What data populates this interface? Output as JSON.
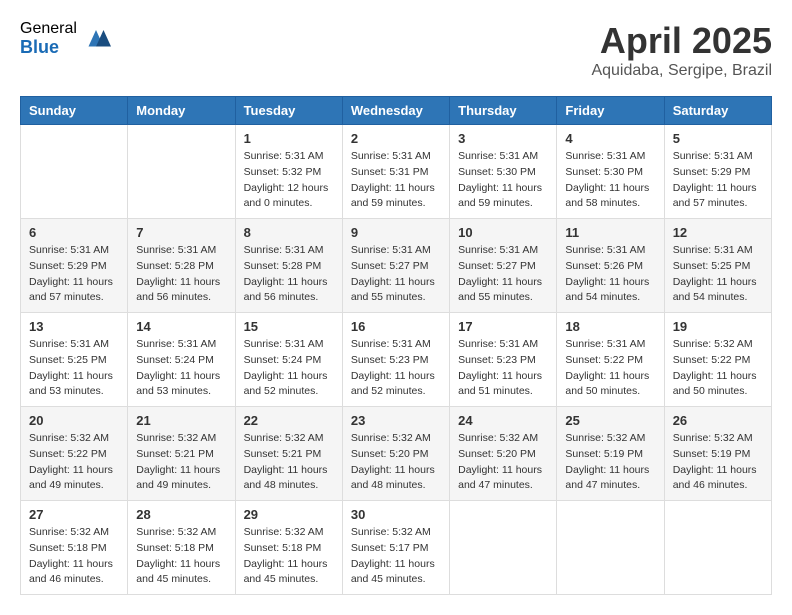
{
  "logo": {
    "general": "General",
    "blue": "Blue"
  },
  "title": "April 2025",
  "location": "Aquidaba, Sergipe, Brazil",
  "headers": [
    "Sunday",
    "Monday",
    "Tuesday",
    "Wednesday",
    "Thursday",
    "Friday",
    "Saturday"
  ],
  "weeks": [
    [
      {
        "day": "",
        "info": ""
      },
      {
        "day": "",
        "info": ""
      },
      {
        "day": "1",
        "info": "Sunrise: 5:31 AM\nSunset: 5:32 PM\nDaylight: 12 hours\nand 0 minutes."
      },
      {
        "day": "2",
        "info": "Sunrise: 5:31 AM\nSunset: 5:31 PM\nDaylight: 11 hours\nand 59 minutes."
      },
      {
        "day": "3",
        "info": "Sunrise: 5:31 AM\nSunset: 5:30 PM\nDaylight: 11 hours\nand 59 minutes."
      },
      {
        "day": "4",
        "info": "Sunrise: 5:31 AM\nSunset: 5:30 PM\nDaylight: 11 hours\nand 58 minutes."
      },
      {
        "day": "5",
        "info": "Sunrise: 5:31 AM\nSunset: 5:29 PM\nDaylight: 11 hours\nand 57 minutes."
      }
    ],
    [
      {
        "day": "6",
        "info": "Sunrise: 5:31 AM\nSunset: 5:29 PM\nDaylight: 11 hours\nand 57 minutes."
      },
      {
        "day": "7",
        "info": "Sunrise: 5:31 AM\nSunset: 5:28 PM\nDaylight: 11 hours\nand 56 minutes."
      },
      {
        "day": "8",
        "info": "Sunrise: 5:31 AM\nSunset: 5:28 PM\nDaylight: 11 hours\nand 56 minutes."
      },
      {
        "day": "9",
        "info": "Sunrise: 5:31 AM\nSunset: 5:27 PM\nDaylight: 11 hours\nand 55 minutes."
      },
      {
        "day": "10",
        "info": "Sunrise: 5:31 AM\nSunset: 5:27 PM\nDaylight: 11 hours\nand 55 minutes."
      },
      {
        "day": "11",
        "info": "Sunrise: 5:31 AM\nSunset: 5:26 PM\nDaylight: 11 hours\nand 54 minutes."
      },
      {
        "day": "12",
        "info": "Sunrise: 5:31 AM\nSunset: 5:25 PM\nDaylight: 11 hours\nand 54 minutes."
      }
    ],
    [
      {
        "day": "13",
        "info": "Sunrise: 5:31 AM\nSunset: 5:25 PM\nDaylight: 11 hours\nand 53 minutes."
      },
      {
        "day": "14",
        "info": "Sunrise: 5:31 AM\nSunset: 5:24 PM\nDaylight: 11 hours\nand 53 minutes."
      },
      {
        "day": "15",
        "info": "Sunrise: 5:31 AM\nSunset: 5:24 PM\nDaylight: 11 hours\nand 52 minutes."
      },
      {
        "day": "16",
        "info": "Sunrise: 5:31 AM\nSunset: 5:23 PM\nDaylight: 11 hours\nand 52 minutes."
      },
      {
        "day": "17",
        "info": "Sunrise: 5:31 AM\nSunset: 5:23 PM\nDaylight: 11 hours\nand 51 minutes."
      },
      {
        "day": "18",
        "info": "Sunrise: 5:31 AM\nSunset: 5:22 PM\nDaylight: 11 hours\nand 50 minutes."
      },
      {
        "day": "19",
        "info": "Sunrise: 5:32 AM\nSunset: 5:22 PM\nDaylight: 11 hours\nand 50 minutes."
      }
    ],
    [
      {
        "day": "20",
        "info": "Sunrise: 5:32 AM\nSunset: 5:22 PM\nDaylight: 11 hours\nand 49 minutes."
      },
      {
        "day": "21",
        "info": "Sunrise: 5:32 AM\nSunset: 5:21 PM\nDaylight: 11 hours\nand 49 minutes."
      },
      {
        "day": "22",
        "info": "Sunrise: 5:32 AM\nSunset: 5:21 PM\nDaylight: 11 hours\nand 48 minutes."
      },
      {
        "day": "23",
        "info": "Sunrise: 5:32 AM\nSunset: 5:20 PM\nDaylight: 11 hours\nand 48 minutes."
      },
      {
        "day": "24",
        "info": "Sunrise: 5:32 AM\nSunset: 5:20 PM\nDaylight: 11 hours\nand 47 minutes."
      },
      {
        "day": "25",
        "info": "Sunrise: 5:32 AM\nSunset: 5:19 PM\nDaylight: 11 hours\nand 47 minutes."
      },
      {
        "day": "26",
        "info": "Sunrise: 5:32 AM\nSunset: 5:19 PM\nDaylight: 11 hours\nand 46 minutes."
      }
    ],
    [
      {
        "day": "27",
        "info": "Sunrise: 5:32 AM\nSunset: 5:18 PM\nDaylight: 11 hours\nand 46 minutes."
      },
      {
        "day": "28",
        "info": "Sunrise: 5:32 AM\nSunset: 5:18 PM\nDaylight: 11 hours\nand 45 minutes."
      },
      {
        "day": "29",
        "info": "Sunrise: 5:32 AM\nSunset: 5:18 PM\nDaylight: 11 hours\nand 45 minutes."
      },
      {
        "day": "30",
        "info": "Sunrise: 5:32 AM\nSunset: 5:17 PM\nDaylight: 11 hours\nand 45 minutes."
      },
      {
        "day": "",
        "info": ""
      },
      {
        "day": "",
        "info": ""
      },
      {
        "day": "",
        "info": ""
      }
    ]
  ]
}
